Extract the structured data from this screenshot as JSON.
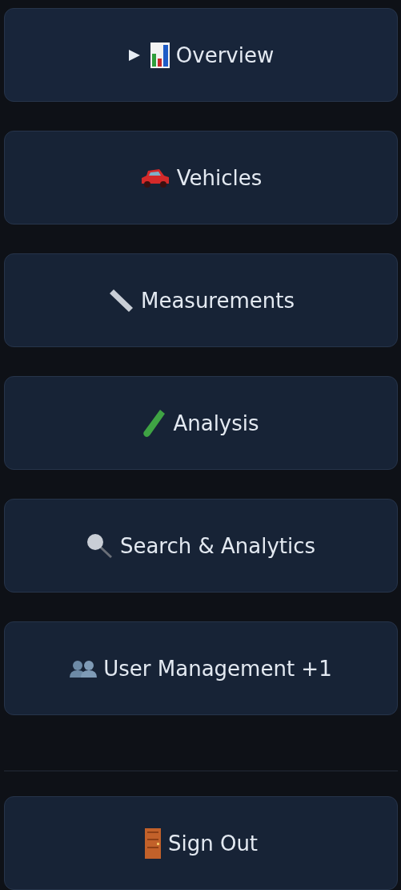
{
  "nav_items": [
    {
      "label": "Overview",
      "selected": true
    },
    {
      "label": "Vehicles",
      "selected": false
    },
    {
      "label": "Measurements",
      "selected": false
    },
    {
      "label": "Analysis",
      "selected": false
    },
    {
      "label": "Search & Analytics",
      "selected": false
    },
    {
      "label": "User Management +1",
      "selected": false
    }
  ],
  "sign_out": {
    "label": "Sign Out"
  }
}
